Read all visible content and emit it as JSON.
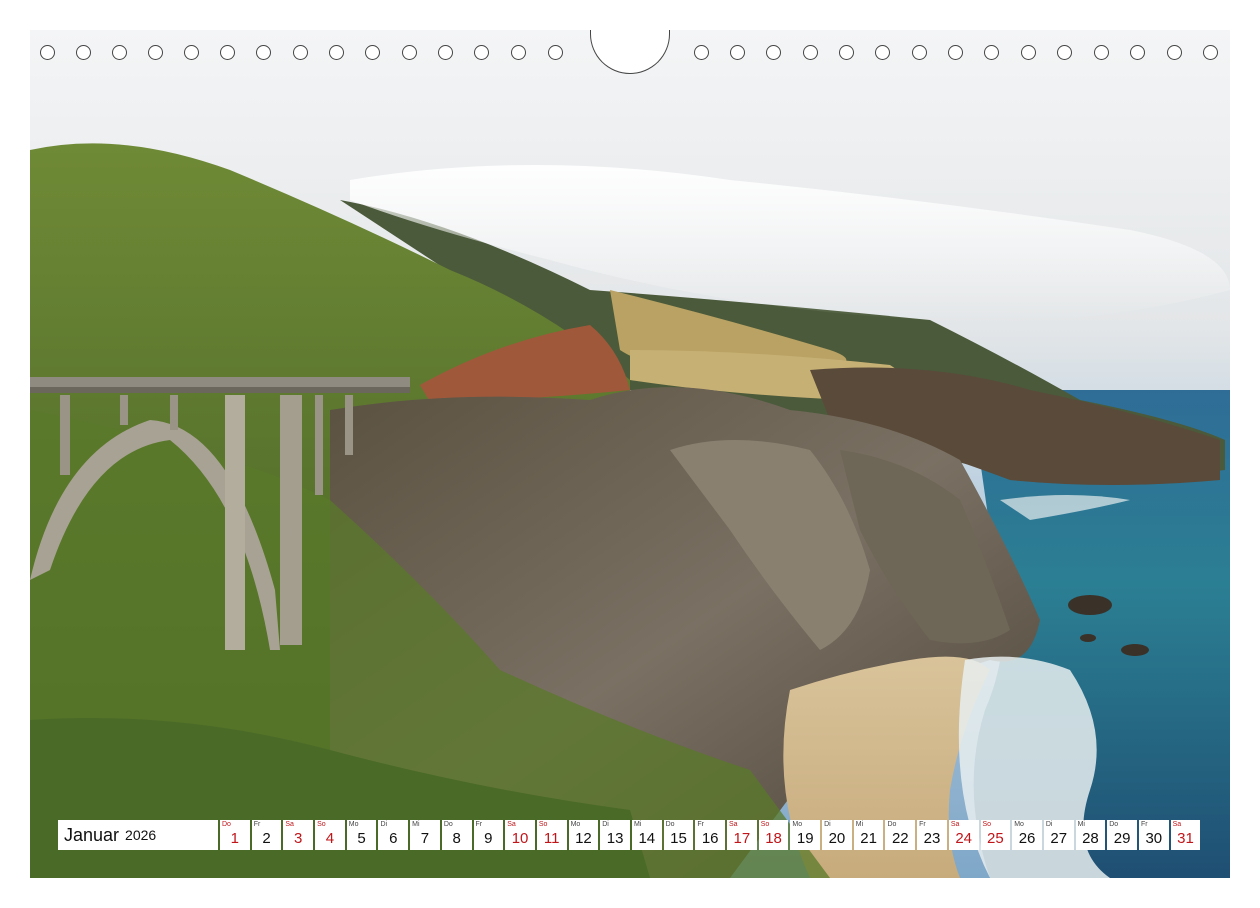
{
  "calendar": {
    "month": "Januar",
    "year": "2026",
    "weekend_color": "#c0161a",
    "days": [
      {
        "wd": "Do",
        "n": "1",
        "we": true
      },
      {
        "wd": "Fr",
        "n": "2",
        "we": false
      },
      {
        "wd": "Sa",
        "n": "3",
        "we": true
      },
      {
        "wd": "So",
        "n": "4",
        "we": true
      },
      {
        "wd": "Mo",
        "n": "5",
        "we": false
      },
      {
        "wd": "Di",
        "n": "6",
        "we": false
      },
      {
        "wd": "Mi",
        "n": "7",
        "we": false
      },
      {
        "wd": "Do",
        "n": "8",
        "we": false
      },
      {
        "wd": "Fr",
        "n": "9",
        "we": false
      },
      {
        "wd": "Sa",
        "n": "10",
        "we": true
      },
      {
        "wd": "So",
        "n": "11",
        "we": true
      },
      {
        "wd": "Mo",
        "n": "12",
        "we": false
      },
      {
        "wd": "Di",
        "n": "13",
        "we": false
      },
      {
        "wd": "Mi",
        "n": "14",
        "we": false
      },
      {
        "wd": "Do",
        "n": "15",
        "we": false
      },
      {
        "wd": "Fr",
        "n": "16",
        "we": false
      },
      {
        "wd": "Sa",
        "n": "17",
        "we": true
      },
      {
        "wd": "So",
        "n": "18",
        "we": true
      },
      {
        "wd": "Mo",
        "n": "19",
        "we": false
      },
      {
        "wd": "Di",
        "n": "20",
        "we": false
      },
      {
        "wd": "Mi",
        "n": "21",
        "we": false
      },
      {
        "wd": "Do",
        "n": "22",
        "we": false
      },
      {
        "wd": "Fr",
        "n": "23",
        "we": false
      },
      {
        "wd": "Sa",
        "n": "24",
        "we": true
      },
      {
        "wd": "So",
        "n": "25",
        "we": true
      },
      {
        "wd": "Mo",
        "n": "26",
        "we": false
      },
      {
        "wd": "Di",
        "n": "27",
        "we": false
      },
      {
        "wd": "Mi",
        "n": "28",
        "we": false
      },
      {
        "wd": "Do",
        "n": "29",
        "we": false
      },
      {
        "wd": "Fr",
        "n": "30",
        "we": false
      },
      {
        "wd": "Sa",
        "n": "31",
        "we": true
      }
    ]
  },
  "photo": {
    "subject": "coastal-arch-bridge-cliffs-ocean"
  }
}
